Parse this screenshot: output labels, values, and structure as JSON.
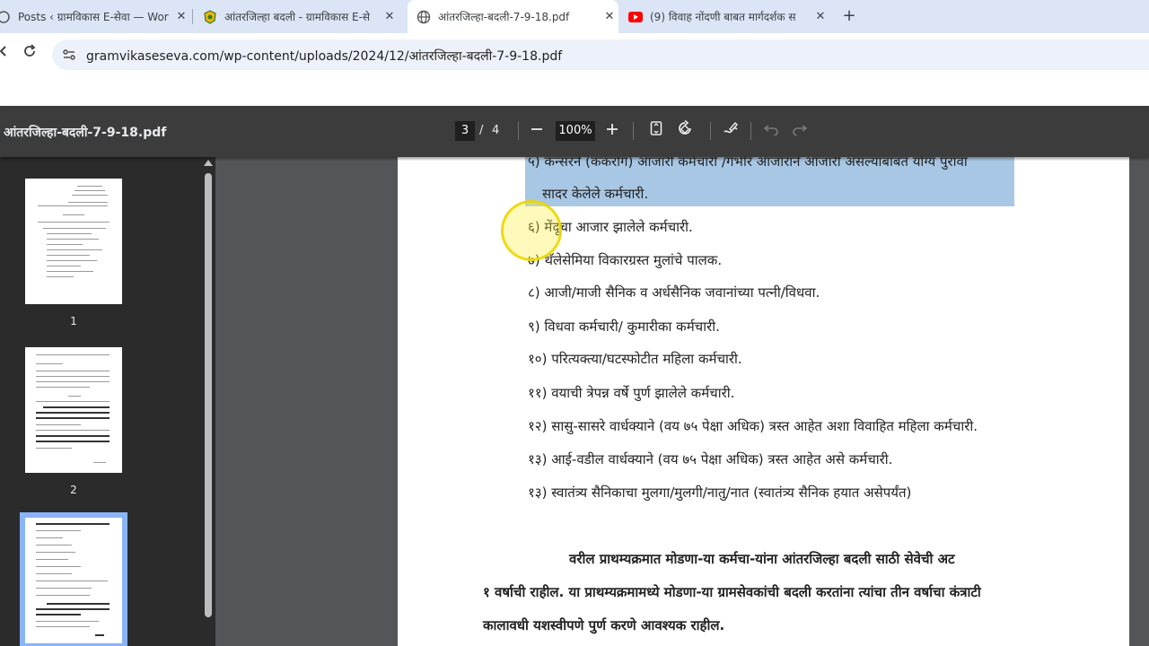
{
  "browser": {
    "tabs": [
      {
        "title": "Posts ‹ ग्रामविकास E-सेवा — Wor",
        "active": false
      },
      {
        "title": "आंतरजिल्हा बदली - ग्रामविकास E-से",
        "active": false
      },
      {
        "title": "आंतरजिल्हा-बदली-7-9-18.pdf",
        "active": true
      },
      {
        "title": "(9) विवाह नोंदणी बाबत मार्गदर्शक स",
        "active": false
      }
    ],
    "new_tab": "+",
    "url": "gramvikaseseva.com/wp-content/uploads/2024/12/आंतरजिल्हा-बदली-7-9-18.pdf",
    "accent": "#dbe5f5"
  },
  "pdf": {
    "title": "आंतरजिल्हा-बदली-7-9-18.pdf",
    "current_page": "3",
    "page_sep": "/",
    "total_pages": "4",
    "zoom": "100%",
    "thumbnails": [
      {
        "label": "1"
      },
      {
        "label": "2"
      }
    ]
  },
  "document": {
    "lines": [
      "५) कॅन्सरने (कॅकरोग) आजारी कर्मचारी /गंभीर आजाराने आजारी असल्याबाबत योग्य पुरावा",
      "सादर केलेले कर्मचारी.",
      "६) मेंदूचा आजार झालेले कर्मचारी.",
      "७) थॅलेसेमिया विकारग्रस्त मुलांचे पालक.",
      "८) आजी/माजी सैनिक व अर्धसैनिक जवानांच्या पत्नी/विधवा.",
      "९) विधवा कर्मचारी/ कुमारीका कर्मचारी.",
      "१०) परित्यक्त्या/घटस्फोटीत महिला कर्मचारी.",
      "११) वयाची त्रेपन्न वर्षे पुर्ण झालेले कर्मचारी.",
      "१२) सासु-सासरे वार्धक्याने (वय ७५ पेक्षा अधिक) त्रस्त आहेत अशा विवाहित महिला कर्मचारी.",
      "१३) आई-वडील वार्धक्याने (वय ७५ पेक्षा अधिक) त्रस्त आहेत असे कर्मचारी.",
      "१३) स्वातंत्र्य सैनिकाचा मुलगा/मुलगी/नातु/नात (स्वातंत्र्य सैनिक हयात असेपर्यंत)"
    ],
    "para": [
      "वरील प्राथम्यक्रमात  मोडणा-या  कर्मचा-यांना  आंतरजिल्हा बदली साठी सेवेची अट",
      "१ वर्षाची राहील. या प्राथम्यक्रमामध्ये मोडणा-या  ग्रामसेवकांची बदली करतांना त्यांचा तीन वर्षाचा कंत्राटी",
      "कालावधी यशस्वीपणे पुर्ण करणे आवश्यक राहील."
    ]
  }
}
